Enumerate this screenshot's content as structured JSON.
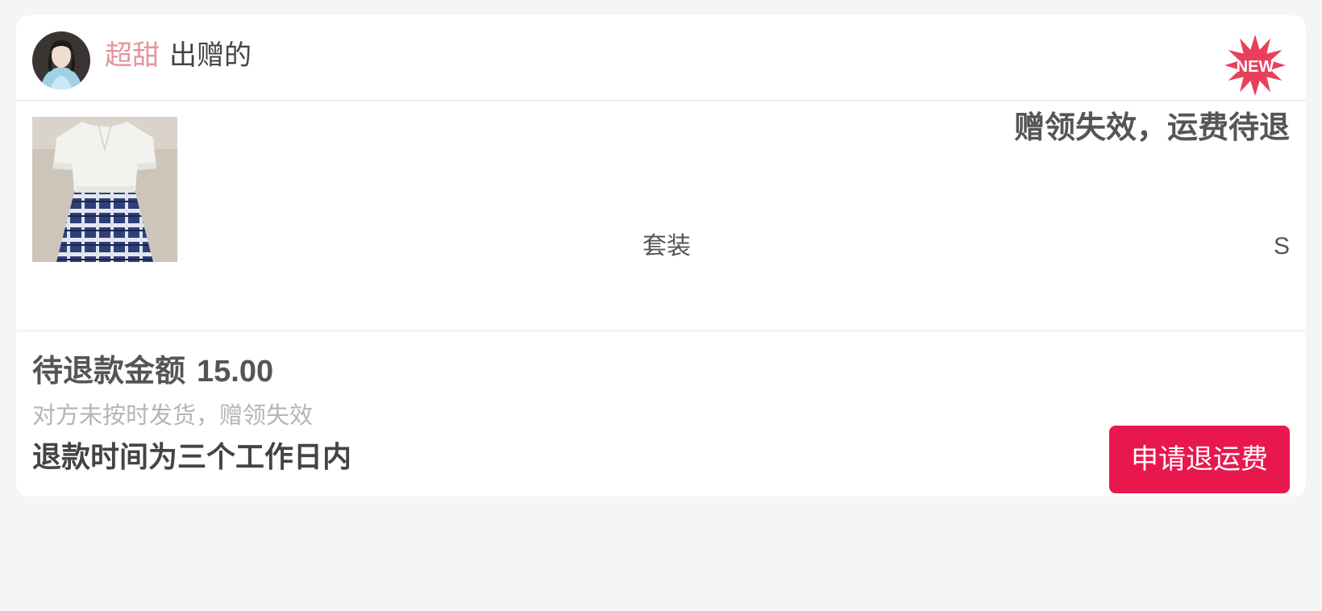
{
  "header": {
    "sender_name": "超甜",
    "sender_suffix": "出赠的",
    "badge": "NEW"
  },
  "product": {
    "status": "赠领失效，运费待退",
    "type": "套装",
    "size": "S"
  },
  "footer": {
    "refund_label": "待退款金额",
    "refund_amount": "15.00",
    "reason": "对方未按时发货，赠领失效",
    "time_note": "退款时间为三个工作日内",
    "apply_button": "申请退运费"
  },
  "colors": {
    "accent": "#e8184f",
    "sender_name": "#e6939c",
    "badge": "#e8405a",
    "background": "#f5f5f5"
  }
}
